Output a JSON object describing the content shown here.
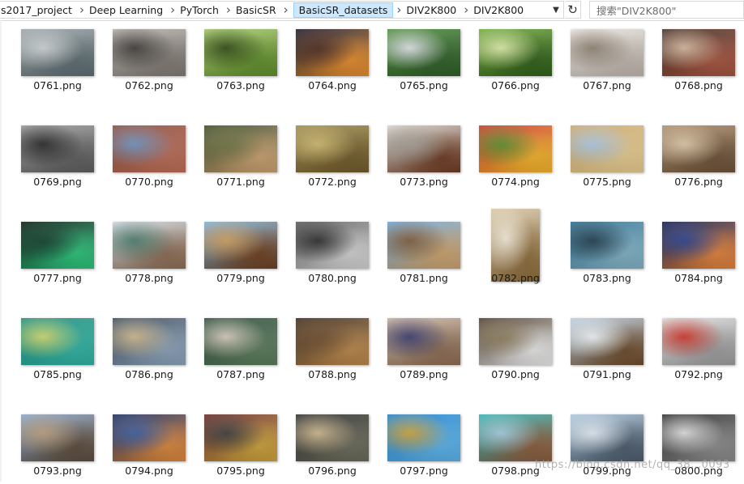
{
  "breadcrumb": [
    "s2017_project",
    "Deep Learning",
    "PyTorch",
    "BasicSR",
    "BasicSR_datasets",
    "DIV2K800",
    "DIV2K800"
  ],
  "active_crumb": 4,
  "search_placeholder": "搜索\"DIV2K800\"",
  "watermark": "https://blog.csdn.net/qq_38…0093",
  "files": [
    {
      "name": "0761.png",
      "colors": [
        "#9aa3a6",
        "#5b6a6f",
        "#c9cfd1"
      ]
    },
    {
      "name": "0762.png",
      "colors": [
        "#b5b0aa",
        "#7d7771",
        "#3d3a37"
      ]
    },
    {
      "name": "0763.png",
      "colors": [
        "#a7c96b",
        "#5e8c2a",
        "#2f4a12"
      ]
    },
    {
      "name": "0764.png",
      "colors": [
        "#1b1b2e",
        "#e38b2c",
        "#4a2a1e"
      ]
    },
    {
      "name": "0765.png",
      "colors": [
        "#4d8a3c",
        "#2d5d26",
        "#d9dde2"
      ]
    },
    {
      "name": "0766.png",
      "colors": [
        "#6fa63a",
        "#2f5e18",
        "#d7e7a3"
      ]
    },
    {
      "name": "0767.png",
      "colors": [
        "#e7e3df",
        "#bcb3aa",
        "#8d7f70"
      ]
    },
    {
      "name": "0768.png",
      "colors": [
        "#3f2b22",
        "#a4533e",
        "#d0b39a"
      ]
    },
    {
      "name": "0769.png",
      "colors": [
        "#9a9a9a",
        "#5c5c5c",
        "#262626"
      ]
    },
    {
      "name": "0770.png",
      "colors": [
        "#8a4a3a",
        "#b86b55",
        "#6e8fb9"
      ]
    },
    {
      "name": "0771.png",
      "colors": [
        "#3a4a2a",
        "#c89f6e",
        "#6b6f3e"
      ]
    },
    {
      "name": "0772.png",
      "colors": [
        "#9a8a4a",
        "#6f5a2a",
        "#c9b36a"
      ]
    },
    {
      "name": "0773.png",
      "colors": [
        "#d8d5d0",
        "#6b3a22",
        "#a09a90"
      ]
    },
    {
      "name": "0774.png",
      "colors": [
        "#c9352a",
        "#f0b12a",
        "#5a8a2a"
      ]
    },
    {
      "name": "0775.png",
      "colors": [
        "#c7a56a",
        "#e3c88e",
        "#a9c4de"
      ]
    },
    {
      "name": "0776.png",
      "colors": [
        "#a98b6a",
        "#6b5137",
        "#d8c2a2"
      ]
    },
    {
      "name": "0777.png",
      "colors": [
        "#0a1a12",
        "#2bc27a",
        "#0f3d2a"
      ]
    },
    {
      "name": "0778.png",
      "colors": [
        "#cfd9e2",
        "#8a6a52",
        "#4a7a6a"
      ]
    },
    {
      "name": "0779.png",
      "colors": [
        "#7fb3d9",
        "#6b3e1e",
        "#c99a5a"
      ]
    },
    {
      "name": "0780.png",
      "colors": [
        "#5a5a5a",
        "#d0d0d0",
        "#2a2a2a"
      ]
    },
    {
      "name": "0781.png",
      "colors": [
        "#6fa6d6",
        "#c9a06a",
        "#7a5a3a"
      ]
    },
    {
      "name": "0782.png",
      "colors": [
        "#d7c6a6",
        "#8a6a3a",
        "#efe6d2"
      ]
    },
    {
      "name": "0783.png",
      "colors": [
        "#2f6e8f",
        "#7fb0c4",
        "#1d3a4a"
      ]
    },
    {
      "name": "0784.png",
      "colors": [
        "#0e1a4a",
        "#e0813a",
        "#2a3f8a"
      ]
    },
    {
      "name": "0785.png",
      "colors": [
        "#1e8a7a",
        "#2fb0a0",
        "#c9d46a"
      ]
    },
    {
      "name": "0786.png",
      "colors": [
        "#3a4a5a",
        "#8aa0b6",
        "#c9b38a"
      ]
    },
    {
      "name": "0787.png",
      "colors": [
        "#2a4a3a",
        "#5a7a5a",
        "#d0c6b6"
      ]
    },
    {
      "name": "0788.png",
      "colors": [
        "#3a2a1e",
        "#b8864a",
        "#6b4a2a"
      ]
    },
    {
      "name": "0789.png",
      "colors": [
        "#c9b6a2",
        "#8a6a52",
        "#3a3a6a"
      ]
    },
    {
      "name": "0790.png",
      "colors": [
        "#4a3a2a",
        "#e6e6e6",
        "#8a7a5a"
      ]
    },
    {
      "name": "0791.png",
      "colors": [
        "#b9cde0",
        "#6b4a2a",
        "#e8eef2"
      ]
    },
    {
      "name": "0792.png",
      "colors": [
        "#dcdcdc",
        "#9a9a9a",
        "#c9352a"
      ]
    },
    {
      "name": "0793.png",
      "colors": [
        "#8aa6c9",
        "#5a4a3a",
        "#b59a7a"
      ]
    },
    {
      "name": "0794.png",
      "colors": [
        "#1a2a5a",
        "#d9853a",
        "#3a5a9a"
      ]
    },
    {
      "name": "0795.png",
      "colors": [
        "#6a2a2a",
        "#c9a03a",
        "#3a3a3a"
      ]
    },
    {
      "name": "0796.png",
      "colors": [
        "#2a2a2a",
        "#6a6a5a",
        "#c9b38a"
      ]
    },
    {
      "name": "0797.png",
      "colors": [
        "#1e7fc9",
        "#5ab0e6",
        "#c9a03a"
      ]
    },
    {
      "name": "0798.png",
      "colors": [
        "#2fb0b0",
        "#8a5a3a",
        "#a0c6d6"
      ]
    },
    {
      "name": "0799.png",
      "colors": [
        "#a9c4dc",
        "#4a5a6a",
        "#dde6ee"
      ]
    },
    {
      "name": "0800.png",
      "colors": [
        "#2a2a2a",
        "#8a8a8a",
        "#d9d9d9"
      ]
    }
  ]
}
